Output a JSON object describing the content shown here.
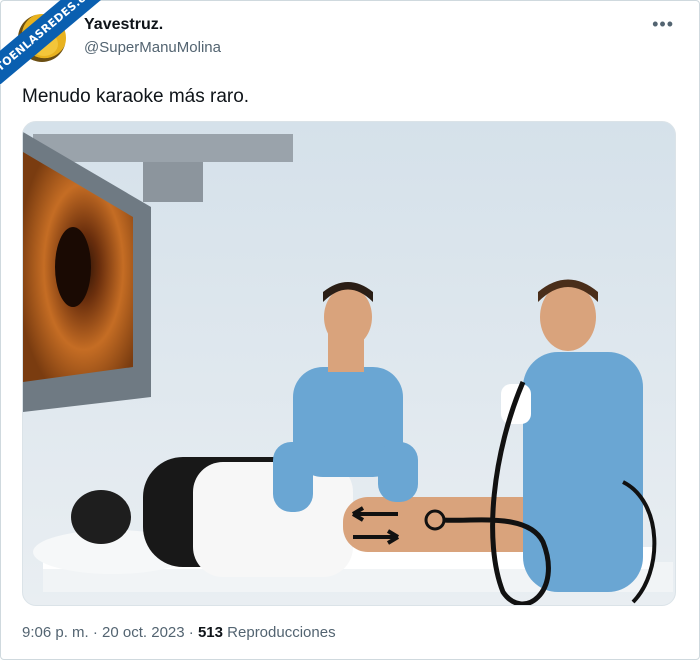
{
  "watermark": {
    "text": "VISTOENLASREDES",
    "sub": ".com"
  },
  "author": {
    "name": "Yavestruz.",
    "handle": "@SuperManuMolina"
  },
  "menu_icon": "ellipsis-icon",
  "tweet": {
    "text": "Menudo karaoke más raro."
  },
  "meta": {
    "time": "9:06 p. m.",
    "separator": "·",
    "date": "20 oct. 2023",
    "views_count": "513",
    "views_label": "Reproducciones"
  },
  "colors": {
    "accent": "#0a5fb0",
    "scrub": "#6aa6d3",
    "skin": "#d9a37c",
    "text_secondary": "#536471"
  }
}
